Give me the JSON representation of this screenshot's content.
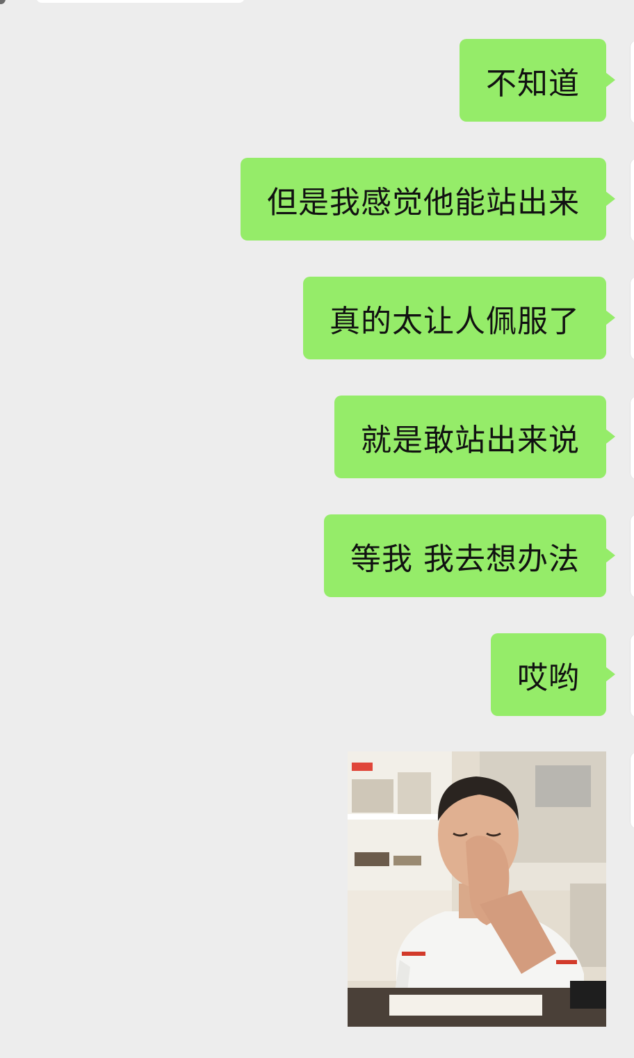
{
  "messages": [
    {
      "text": "不知道"
    },
    {
      "text": "但是我感觉他能站出来"
    },
    {
      "text": "真的太让人佩服了"
    },
    {
      "text": "就是敢站出来说"
    },
    {
      "text": "等我 我去想办法"
    },
    {
      "text": "哎哟"
    }
  ],
  "image_message": {
    "description": "sticker"
  },
  "colors": {
    "background": "#ededed",
    "sent_bubble": "#95ec69",
    "text": "#111111"
  }
}
